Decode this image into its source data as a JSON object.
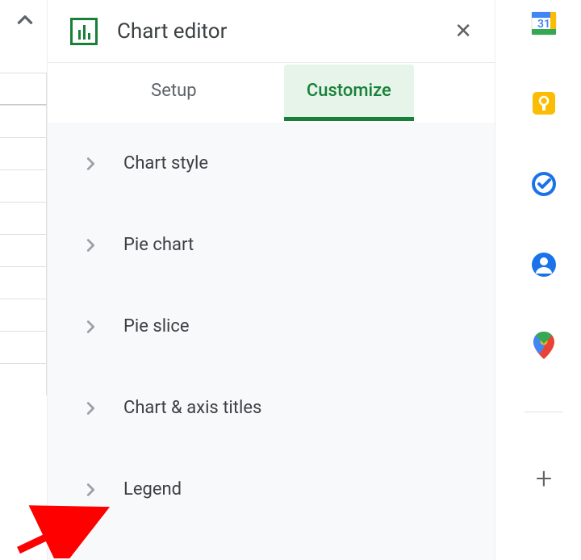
{
  "header": {
    "title": "Chart editor"
  },
  "tabs": {
    "setup": "Setup",
    "customize": "Customize"
  },
  "sections": {
    "chart_style": "Chart style",
    "pie_chart": "Pie chart",
    "pie_slice": "Pie slice",
    "chart_axis_titles": "Chart & axis titles",
    "legend": "Legend"
  },
  "side_rail": {
    "calendar": "31"
  }
}
